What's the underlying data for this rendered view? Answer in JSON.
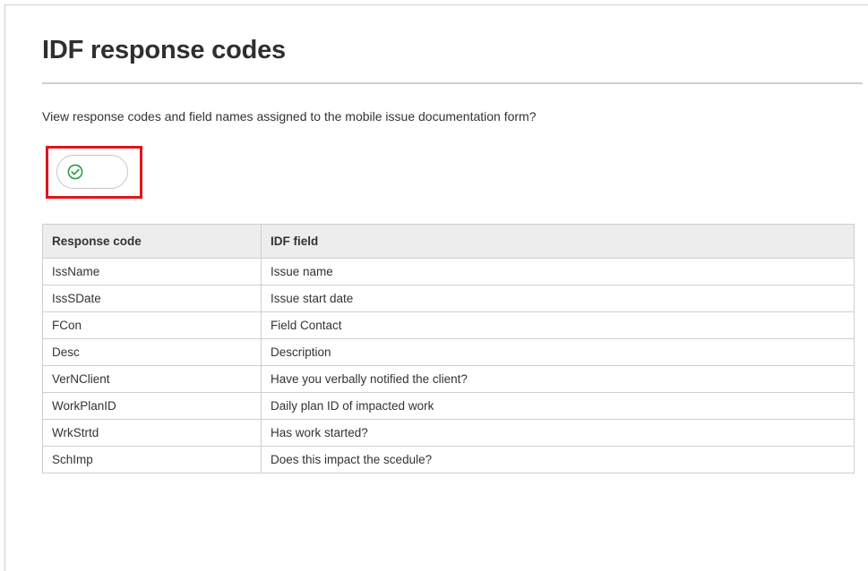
{
  "page": {
    "title": "IDF response codes",
    "intro": "View response codes and field names assigned to the mobile issue documentation form?"
  },
  "toggle": {
    "state": "on",
    "icon": "check-circle-icon",
    "accent_color": "#2e9e3f",
    "highlight_color": "#e0141b"
  },
  "table": {
    "headers": [
      "Response code",
      "IDF field"
    ],
    "rows": [
      [
        "IssName",
        "Issue name"
      ],
      [
        "IssSDate",
        "Issue start date"
      ],
      [
        "FCon",
        "Field Contact"
      ],
      [
        "Desc",
        "Description"
      ],
      [
        "VerNClient",
        "Have you verbally notified the client?"
      ],
      [
        "WorkPlanID",
        "Daily plan ID of impacted work"
      ],
      [
        "WrkStrtd",
        "Has work started?"
      ],
      [
        "SchImp",
        "Does this impact the scedule?"
      ]
    ]
  }
}
